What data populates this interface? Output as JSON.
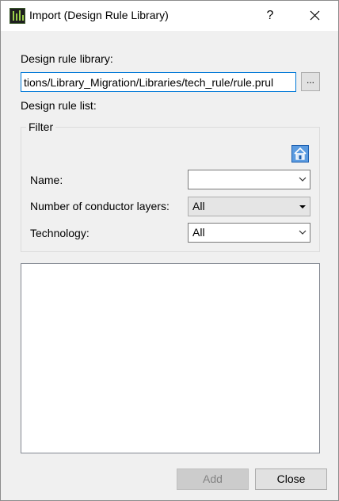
{
  "window": {
    "title": "Import (Design Rule Library)",
    "help_glyph": "?",
    "close_icon": "close-icon",
    "app_icon": "app-icon"
  },
  "library": {
    "label": "Design rule library:",
    "path_value": "tions/Library_Migration/Libraries/tech_rule/rule.prul",
    "browse_label": "..."
  },
  "list_label": "Design rule list:",
  "filter": {
    "title": "Filter",
    "home_icon": "home-icon",
    "name_label": "Name:",
    "name_value": "",
    "layers_label": "Number of conductor layers:",
    "layers_value": "All",
    "technology_label": "Technology:",
    "technology_value": "All"
  },
  "rule_list": [],
  "buttons": {
    "add_label": "Add",
    "add_enabled": false,
    "close_label": "Close"
  },
  "colors": {
    "accent": "#0078d7",
    "dialog_bg": "#f0f0f0",
    "disabled_text": "#838383"
  }
}
